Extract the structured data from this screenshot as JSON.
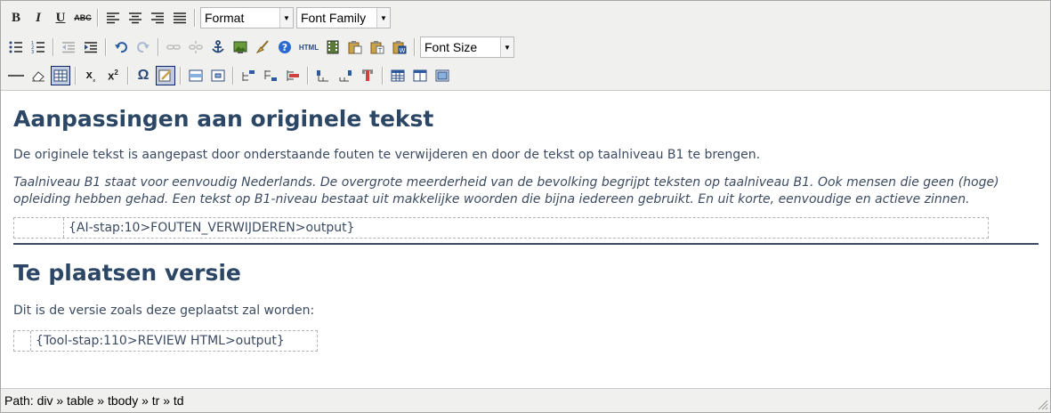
{
  "toolbar": {
    "format_label": "Format",
    "font_family_label": "Font Family",
    "font_size_label": "Font Size",
    "html_label": "HTML"
  },
  "content": {
    "heading1": "Aanpassingen aan originele tekst",
    "para1": "De originele tekst is aangepast door onderstaande fouten te verwijderen en door de tekst op taalniveau B1 te brengen.",
    "para2": "Taalniveau B1 staat voor eenvoudig Nederlands. De overgrote meerderheid van de bevolking begrijpt teksten op taalniveau B1. Ook mensen die geen (hoge) opleiding hebben gehad. Een tekst op B1-niveau bestaat uit makkelijke woorden die bijna iedereen gebruikt. En uit korte, eenvoudige en actieve zinnen.",
    "placeholder1": "{AI-stap:10>FOUTEN_VERWIJDEREN>output}",
    "heading2": "Te plaatsen versie",
    "para3": "Dit is de versie zoals deze geplaatst zal worden:",
    "placeholder2": "{Tool-stap:110>REVIEW HTML>output}"
  },
  "statusbar": {
    "path": "Path: div » table » tbody » tr » td"
  }
}
